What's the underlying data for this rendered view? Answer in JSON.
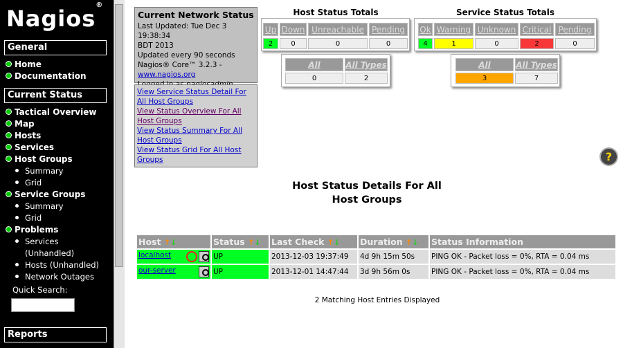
{
  "sidebar": {
    "logo": "Nagios",
    "logo_mark": "®",
    "general": "General",
    "home": "Home",
    "documentation": "Documentation",
    "current_status": "Current Status",
    "tactical": "Tactical Overview",
    "map": "Map",
    "hosts": "Hosts",
    "services": "Services",
    "host_groups": "Host Groups",
    "hg_summary": "Summary",
    "hg_grid": "Grid",
    "service_groups": "Service Groups",
    "sg_summary": "Summary",
    "sg_grid": "Grid",
    "problems": "Problems",
    "p_services": "Services",
    "p_unhandled": "(Unhandled)",
    "p_hosts": "Hosts (Unhandled)",
    "p_outages": "Network Outages",
    "quick_search": "Quick Search:",
    "reports": "Reports"
  },
  "status_box": {
    "title": "Current Network Status",
    "updated": "Last Updated: Tue Dec 3 19:38:34",
    "updated2": "BDT 2013",
    "interval": "Updated every 90 seconds",
    "core": "Nagios® Core™ 3.2.3 -",
    "link": "www.nagios.org",
    "logged": "Logged in as ",
    "user": "nagiosadmin"
  },
  "links": [
    "View Service Status Detail For All Host Groups",
    "View Status Overview For All Host Groups",
    "View Status Summary For All Host Groups",
    "View Status Grid For All Host Groups"
  ],
  "host_totals": {
    "title": "Host Status Totals",
    "headers": [
      "Up",
      "Down",
      "Unreachable",
      "Pending"
    ],
    "values": [
      "2",
      "0",
      "0",
      "0"
    ],
    "all_problems": "All Problems",
    "all_types": "All Types",
    "problems_value": "0",
    "types_value": "2"
  },
  "service_totals": {
    "title": "Service Status Totals",
    "headers": [
      "Ok",
      "Warning",
      "Unknown",
      "Critical",
      "Pending"
    ],
    "values": [
      "4",
      "1",
      "0",
      "2",
      "0"
    ],
    "all_problems": "All Problems",
    "all_types": "All Types",
    "problems_value": "3",
    "types_value": "7"
  },
  "main": {
    "title1": "Host Status Details For All",
    "title2": "Host Groups",
    "help": "?"
  },
  "table": {
    "headers": [
      "Host",
      "Status",
      "Last Check",
      "Duration",
      "Status Information"
    ],
    "rows": [
      {
        "host": "localhost",
        "status": "UP",
        "last": "2013-12-03 19:37:49",
        "duration": "4d 9h 15m 50s",
        "info": "PING OK - Packet loss = 0%, RTA = 0.04 ms"
      },
      {
        "host": "our-server",
        "status": "UP",
        "last": "2013-12-01 14:47:44",
        "duration": "3d 9h 56m 0s",
        "info": "PING OK - Packet loss = 0%, RTA = 0.04 ms"
      }
    ],
    "count": "2 Matching Host Entries Displayed"
  },
  "colors": {
    "up": "#00ff22",
    "warning": "#ffff00",
    "critical": "#f83838",
    "problems": "#ffa500"
  }
}
